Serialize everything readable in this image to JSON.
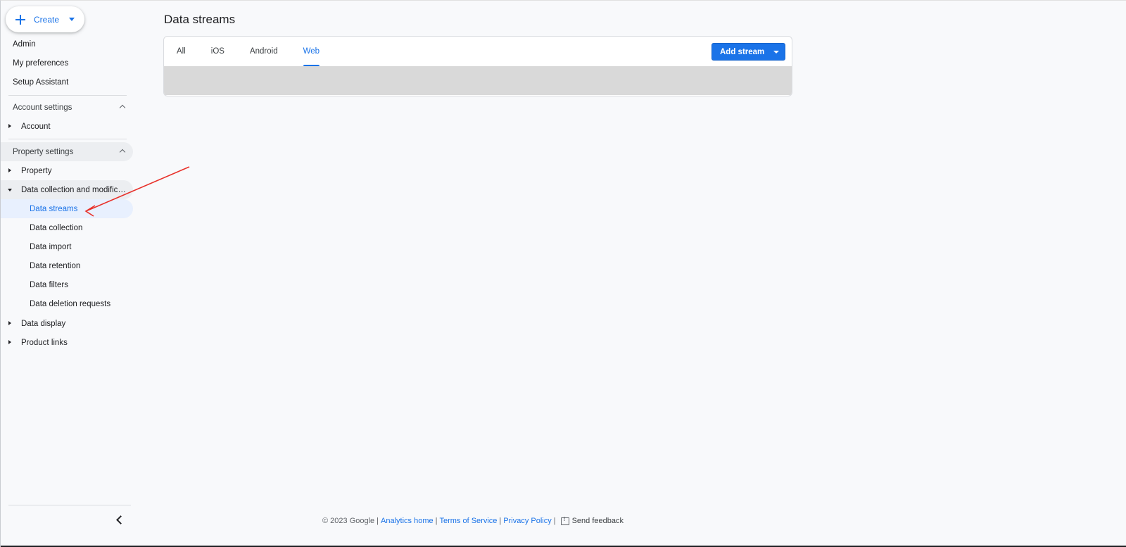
{
  "sidebar": {
    "create_label": "Create",
    "top_items": [
      {
        "label": "Admin"
      },
      {
        "label": "My preferences"
      },
      {
        "label": "Setup Assistant"
      }
    ],
    "account_settings": {
      "heading": "Account settings",
      "items": [
        {
          "label": "Account"
        }
      ]
    },
    "property_settings": {
      "heading": "Property settings",
      "items": [
        {
          "label": "Property"
        },
        {
          "label": "Data collection and modifica..."
        }
      ],
      "data_collection_children": [
        {
          "label": "Data streams",
          "active": true
        },
        {
          "label": "Data collection"
        },
        {
          "label": "Data import"
        },
        {
          "label": "Data retention"
        },
        {
          "label": "Data filters"
        },
        {
          "label": "Data deletion requests"
        }
      ],
      "after_items": [
        {
          "label": "Data display"
        },
        {
          "label": "Product links"
        }
      ]
    }
  },
  "main": {
    "title": "Data streams",
    "tabs": [
      {
        "label": "All"
      },
      {
        "label": "iOS"
      },
      {
        "label": "Android"
      },
      {
        "label": "Web",
        "selected": true
      }
    ],
    "add_stream_label": "Add stream"
  },
  "footer": {
    "copyright": "© 2023 Google",
    "analytics_home": "Analytics home",
    "terms": "Terms of Service",
    "privacy": "Privacy Policy",
    "feedback": "Send feedback",
    "separator": "|"
  },
  "colors": {
    "accent": "#1a73e8",
    "active_bg": "#e8f0fe",
    "annotation_arrow": "#e8312a"
  }
}
